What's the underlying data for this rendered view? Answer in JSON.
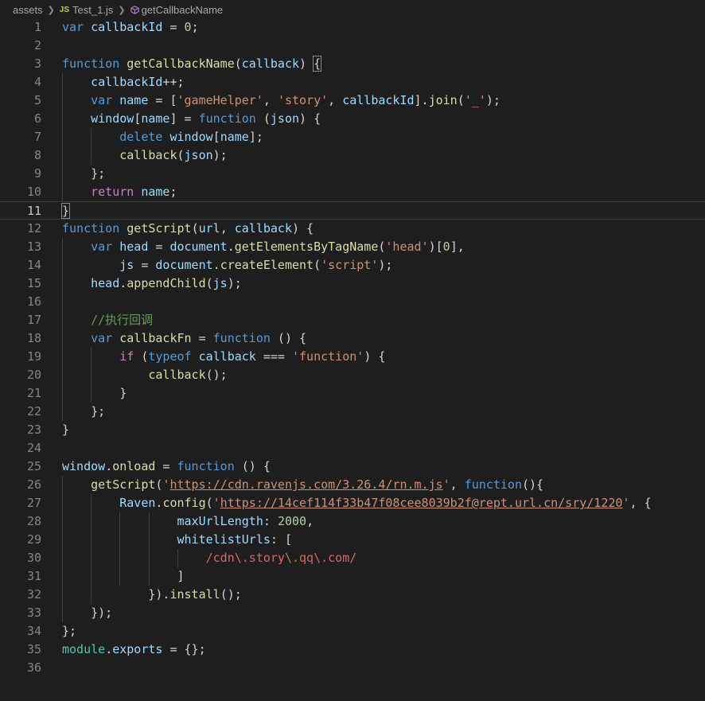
{
  "breadcrumb": {
    "folder": "assets",
    "file_badge": "JS",
    "file": "Test_1.js",
    "symbol": "getCallbackName"
  },
  "editor": {
    "active_line": 11,
    "lines": [
      {
        "n": "1",
        "t": [
          [
            "kw",
            "var"
          ],
          [
            "p",
            " "
          ],
          [
            "v",
            "callbackId"
          ],
          [
            "p",
            " = "
          ],
          [
            "num",
            "0"
          ],
          [
            "p",
            ";"
          ]
        ]
      },
      {
        "n": "2",
        "t": []
      },
      {
        "n": "3",
        "t": [
          [
            "kw",
            "function"
          ],
          [
            "p",
            " "
          ],
          [
            "fn",
            "getCallbackName"
          ],
          [
            "p",
            "("
          ],
          [
            "v",
            "callback"
          ],
          [
            "p",
            ") "
          ],
          [
            "bm",
            "{"
          ]
        ]
      },
      {
        "n": "4",
        "t": [
          [
            "p",
            "    "
          ],
          [
            "v",
            "callbackId"
          ],
          [
            "p",
            "++;"
          ]
        ]
      },
      {
        "n": "5",
        "t": [
          [
            "p",
            "    "
          ],
          [
            "kw",
            "var"
          ],
          [
            "p",
            " "
          ],
          [
            "v",
            "name"
          ],
          [
            "p",
            " = ["
          ],
          [
            "str",
            "'gameHelper'"
          ],
          [
            "p",
            ", "
          ],
          [
            "str",
            "'story'"
          ],
          [
            "p",
            ", "
          ],
          [
            "v",
            "callbackId"
          ],
          [
            "p",
            "]."
          ],
          [
            "fn",
            "join"
          ],
          [
            "p",
            "("
          ],
          [
            "str",
            "'_'"
          ],
          [
            "p",
            ");"
          ]
        ]
      },
      {
        "n": "6",
        "t": [
          [
            "p",
            "    "
          ],
          [
            "v",
            "window"
          ],
          [
            "p",
            "["
          ],
          [
            "v",
            "name"
          ],
          [
            "p",
            "] = "
          ],
          [
            "kw",
            "function"
          ],
          [
            "p",
            " ("
          ],
          [
            "v",
            "json"
          ],
          [
            "p",
            ") {"
          ]
        ]
      },
      {
        "n": "7",
        "t": [
          [
            "p",
            "        "
          ],
          [
            "kw",
            "delete"
          ],
          [
            "p",
            " "
          ],
          [
            "v",
            "window"
          ],
          [
            "p",
            "["
          ],
          [
            "v",
            "name"
          ],
          [
            "p",
            "];"
          ]
        ]
      },
      {
        "n": "8",
        "t": [
          [
            "p",
            "        "
          ],
          [
            "fn",
            "callback"
          ],
          [
            "p",
            "("
          ],
          [
            "v",
            "json"
          ],
          [
            "p",
            ");"
          ]
        ]
      },
      {
        "n": "9",
        "t": [
          [
            "p",
            "    };"
          ]
        ]
      },
      {
        "n": "10",
        "t": [
          [
            "p",
            "    "
          ],
          [
            "ctl",
            "return"
          ],
          [
            "p",
            " "
          ],
          [
            "v",
            "name"
          ],
          [
            "p",
            ";"
          ]
        ]
      },
      {
        "n": "11",
        "t": [
          [
            "bm",
            "}"
          ]
        ]
      },
      {
        "n": "12",
        "t": [
          [
            "kw",
            "function"
          ],
          [
            "p",
            " "
          ],
          [
            "fn",
            "getScript"
          ],
          [
            "p",
            "("
          ],
          [
            "v",
            "url"
          ],
          [
            "p",
            ", "
          ],
          [
            "v",
            "callback"
          ],
          [
            "p",
            ") {"
          ]
        ]
      },
      {
        "n": "13",
        "t": [
          [
            "p",
            "    "
          ],
          [
            "kw",
            "var"
          ],
          [
            "p",
            " "
          ],
          [
            "v",
            "head"
          ],
          [
            "p",
            " = "
          ],
          [
            "v",
            "document"
          ],
          [
            "p",
            "."
          ],
          [
            "fn",
            "getElementsByTagName"
          ],
          [
            "p",
            "("
          ],
          [
            "str",
            "'head'"
          ],
          [
            "p",
            ")["
          ],
          [
            "num",
            "0"
          ],
          [
            "p",
            "],"
          ]
        ]
      },
      {
        "n": "14",
        "t": [
          [
            "p",
            "        "
          ],
          [
            "v",
            "js"
          ],
          [
            "p",
            " = "
          ],
          [
            "v",
            "document"
          ],
          [
            "p",
            "."
          ],
          [
            "fn",
            "createElement"
          ],
          [
            "p",
            "("
          ],
          [
            "str",
            "'script'"
          ],
          [
            "p",
            ");"
          ]
        ]
      },
      {
        "n": "15",
        "t": [
          [
            "p",
            "    "
          ],
          [
            "v",
            "head"
          ],
          [
            "p",
            "."
          ],
          [
            "fn",
            "appendChild"
          ],
          [
            "p",
            "("
          ],
          [
            "v",
            "js"
          ],
          [
            "p",
            ");"
          ]
        ]
      },
      {
        "n": "16",
        "t": []
      },
      {
        "n": "17",
        "t": [
          [
            "p",
            "    "
          ],
          [
            "cmt",
            "//执行回调"
          ]
        ]
      },
      {
        "n": "18",
        "t": [
          [
            "p",
            "    "
          ],
          [
            "kw",
            "var"
          ],
          [
            "p",
            " "
          ],
          [
            "fn",
            "callbackFn"
          ],
          [
            "p",
            " = "
          ],
          [
            "kw",
            "function"
          ],
          [
            "p",
            " () {"
          ]
        ]
      },
      {
        "n": "19",
        "t": [
          [
            "p",
            "        "
          ],
          [
            "ctl",
            "if"
          ],
          [
            "p",
            " ("
          ],
          [
            "kw",
            "typeof"
          ],
          [
            "p",
            " "
          ],
          [
            "v",
            "callback"
          ],
          [
            "p",
            " === "
          ],
          [
            "str",
            "'function'"
          ],
          [
            "p",
            ") {"
          ]
        ]
      },
      {
        "n": "20",
        "t": [
          [
            "p",
            "            "
          ],
          [
            "fn",
            "callback"
          ],
          [
            "p",
            "();"
          ]
        ]
      },
      {
        "n": "21",
        "t": [
          [
            "p",
            "        }"
          ]
        ]
      },
      {
        "n": "22",
        "t": [
          [
            "p",
            "    };"
          ]
        ]
      },
      {
        "n": "23",
        "t": [
          [
            "p",
            "}"
          ]
        ]
      },
      {
        "n": "24",
        "t": []
      },
      {
        "n": "25",
        "t": [
          [
            "v",
            "window"
          ],
          [
            "p",
            "."
          ],
          [
            "fn",
            "onload"
          ],
          [
            "p",
            " = "
          ],
          [
            "kw",
            "function"
          ],
          [
            "p",
            " () {"
          ]
        ]
      },
      {
        "n": "26",
        "t": [
          [
            "p",
            "    "
          ],
          [
            "fn",
            "getScript"
          ],
          [
            "p",
            "("
          ],
          [
            "str",
            "'"
          ],
          [
            "url",
            "https://cdn.ravenjs.com/3.26.4/rn.m.js"
          ],
          [
            "str",
            "'"
          ],
          [
            "p",
            ", "
          ],
          [
            "kw",
            "function"
          ],
          [
            "p",
            "(){"
          ]
        ]
      },
      {
        "n": "27",
        "t": [
          [
            "p",
            "        "
          ],
          [
            "v",
            "Raven"
          ],
          [
            "p",
            "."
          ],
          [
            "fn",
            "config"
          ],
          [
            "p",
            "("
          ],
          [
            "str",
            "'"
          ],
          [
            "url",
            "https://14cef114f33b47f08cee8039b2f@rept.url.cn/sry/1220"
          ],
          [
            "str",
            "'"
          ],
          [
            "p",
            ", {"
          ]
        ]
      },
      {
        "n": "28",
        "t": [
          [
            "p",
            "                "
          ],
          [
            "v",
            "maxUrlLength"
          ],
          [
            "p",
            ": "
          ],
          [
            "num",
            "2000"
          ],
          [
            "p",
            ","
          ]
        ]
      },
      {
        "n": "29",
        "t": [
          [
            "p",
            "                "
          ],
          [
            "v",
            "whitelistUrls"
          ],
          [
            "p",
            ": ["
          ]
        ]
      },
      {
        "n": "30",
        "t": [
          [
            "p",
            "                    "
          ],
          [
            "rx",
            "/cdn\\.story\\.qq\\.com/"
          ]
        ]
      },
      {
        "n": "31",
        "t": [
          [
            "p",
            "                ]"
          ]
        ]
      },
      {
        "n": "32",
        "t": [
          [
            "p",
            "            })."
          ],
          [
            "fn",
            "install"
          ],
          [
            "p",
            "();"
          ]
        ]
      },
      {
        "n": "33",
        "t": [
          [
            "p",
            "    });"
          ]
        ]
      },
      {
        "n": "34",
        "t": [
          [
            "p",
            "};"
          ]
        ]
      },
      {
        "n": "35",
        "t": [
          [
            "type",
            "module"
          ],
          [
            "p",
            "."
          ],
          [
            "v",
            "exports"
          ],
          [
            "p",
            " = {};"
          ]
        ]
      },
      {
        "n": "36",
        "t": []
      }
    ]
  }
}
